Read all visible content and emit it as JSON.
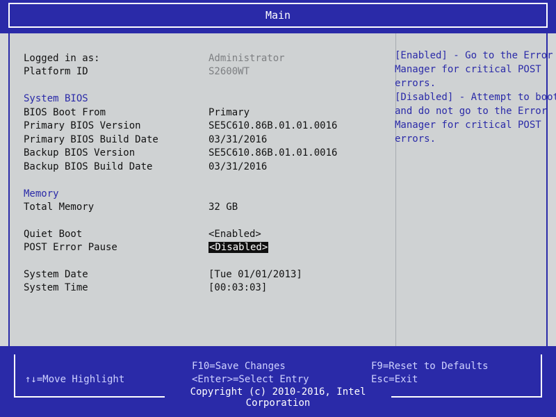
{
  "header": {
    "title": "Main"
  },
  "fields": {
    "logged_in": {
      "label": "Logged in as:",
      "value": "Administrator"
    },
    "platform_id": {
      "label": "Platform ID",
      "value": "S2600WT"
    },
    "system_bios_heading": "System BIOS",
    "bios_boot_from": {
      "label": "BIOS Boot From",
      "value": "Primary"
    },
    "primary_bios_version": {
      "label": "Primary BIOS Version",
      "value": "SE5C610.86B.01.01.0016"
    },
    "primary_bios_build_date": {
      "label": "Primary BIOS Build Date",
      "value": "03/31/2016"
    },
    "backup_bios_version": {
      "label": "Backup BIOS Version",
      "value": "SE5C610.86B.01.01.0016"
    },
    "backup_bios_build_date": {
      "label": "Backup BIOS Build Date",
      "value": "03/31/2016"
    },
    "memory_heading": "Memory",
    "total_memory": {
      "label": "Total Memory",
      "value": "32 GB"
    },
    "quiet_boot": {
      "label": "Quiet Boot",
      "value": "<Enabled>"
    },
    "post_error_pause": {
      "label": "POST Error Pause",
      "value": "<Disabled>"
    },
    "system_date": {
      "label": "System Date",
      "value": "[Tue 01/01/2013]"
    },
    "system_time": {
      "label": "System Time",
      "value": "[00:03:03]"
    }
  },
  "help": {
    "lines": [
      "[Enabled] - Go to the Error",
      "Manager for critical POST",
      "errors.",
      "[Disabled] - Attempt to boot",
      "and do not go to the Error",
      "Manager for critical POST",
      "errors."
    ]
  },
  "footer": {
    "move_highlight": "↑↓=Move Highlight",
    "save_changes": "F10=Save Changes",
    "select_entry": "<Enter>=Select Entry",
    "reset_defaults": "F9=Reset to Defaults",
    "exit": "Esc=Exit",
    "copyright": "Copyright (c) 2010-2016, Intel Corporation"
  },
  "colors": {
    "bios_blue": "#2a2aa8",
    "panel_gray": "#cfd2d3",
    "selection": "#101010"
  }
}
